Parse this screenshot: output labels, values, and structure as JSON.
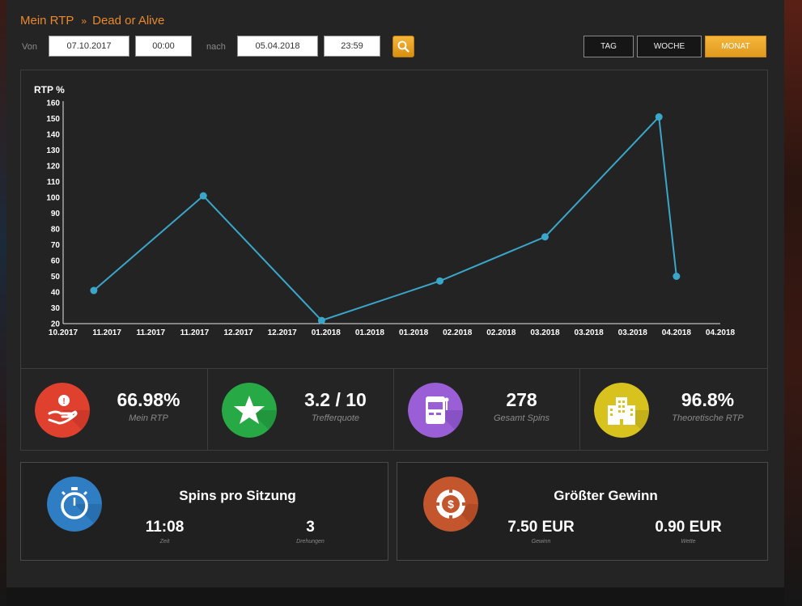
{
  "breadcrumb": {
    "root": "Mein RTP",
    "separator": "»",
    "current": "Dead or Alive"
  },
  "filter": {
    "from_label": "Von",
    "from_date": "07.10.2017",
    "from_time": "00:00",
    "to_label": "nach",
    "to_date": "05.04.2018",
    "to_time": "23:59",
    "search_icon": "search-icon"
  },
  "periods": {
    "day": "TAG",
    "week": "WOCHE",
    "month": "MONAT",
    "active": "month"
  },
  "chart_data": {
    "type": "line",
    "ylabel": "RTP %",
    "ylim": [
      20,
      160
    ],
    "yticks": [
      20,
      30,
      40,
      50,
      60,
      70,
      80,
      90,
      100,
      110,
      120,
      130,
      140,
      150,
      160
    ],
    "xtick_labels": [
      "10.2017",
      "11.2017",
      "11.2017",
      "11.2017",
      "12.2017",
      "12.2017",
      "01.2018",
      "01.2018",
      "01.2018",
      "02.2018",
      "02.2018",
      "03.2018",
      "03.2018",
      "03.2018",
      "04.2018",
      "04.2018"
    ],
    "xlim": [
      0,
      15
    ],
    "series": [
      {
        "color": "#3aa6c9",
        "x": [
          0.7,
          3.2,
          5.9,
          8.6,
          11.0,
          13.6,
          14.0
        ],
        "y": [
          41,
          101,
          22,
          47,
          75,
          151,
          50
        ]
      }
    ],
    "grid": false
  },
  "stats": [
    {
      "value": "66.98%",
      "label": "Mein RTP",
      "icon": "hand-money-icon",
      "color": "#e0402e"
    },
    {
      "value": "3.2 / 10",
      "label": "Trefferquote",
      "icon": "star-icon",
      "color": "#27a945"
    },
    {
      "value": "278",
      "label": "Gesamt Spins",
      "icon": "slot-machine-icon",
      "color": "#9a5fd6"
    },
    {
      "value": "96.8%",
      "label": "Theoretische RTP",
      "icon": "building-icon",
      "color": "#d8c21e"
    }
  ],
  "session": {
    "title": "Spins pro Sitzung",
    "icon": "stopwatch-icon",
    "color": "#2f7ec4",
    "time_value": "11:08",
    "time_label": "Zeit",
    "spins_value": "3",
    "spins_label": "Drehungen"
  },
  "biggest_win": {
    "title": "Größter Gewinn",
    "icon": "casino-chip-icon",
    "color": "#c4562e",
    "win_value": "7.50 EUR",
    "win_label": "Gewinn",
    "bet_value": "0.90 EUR",
    "bet_label": "Wette"
  }
}
